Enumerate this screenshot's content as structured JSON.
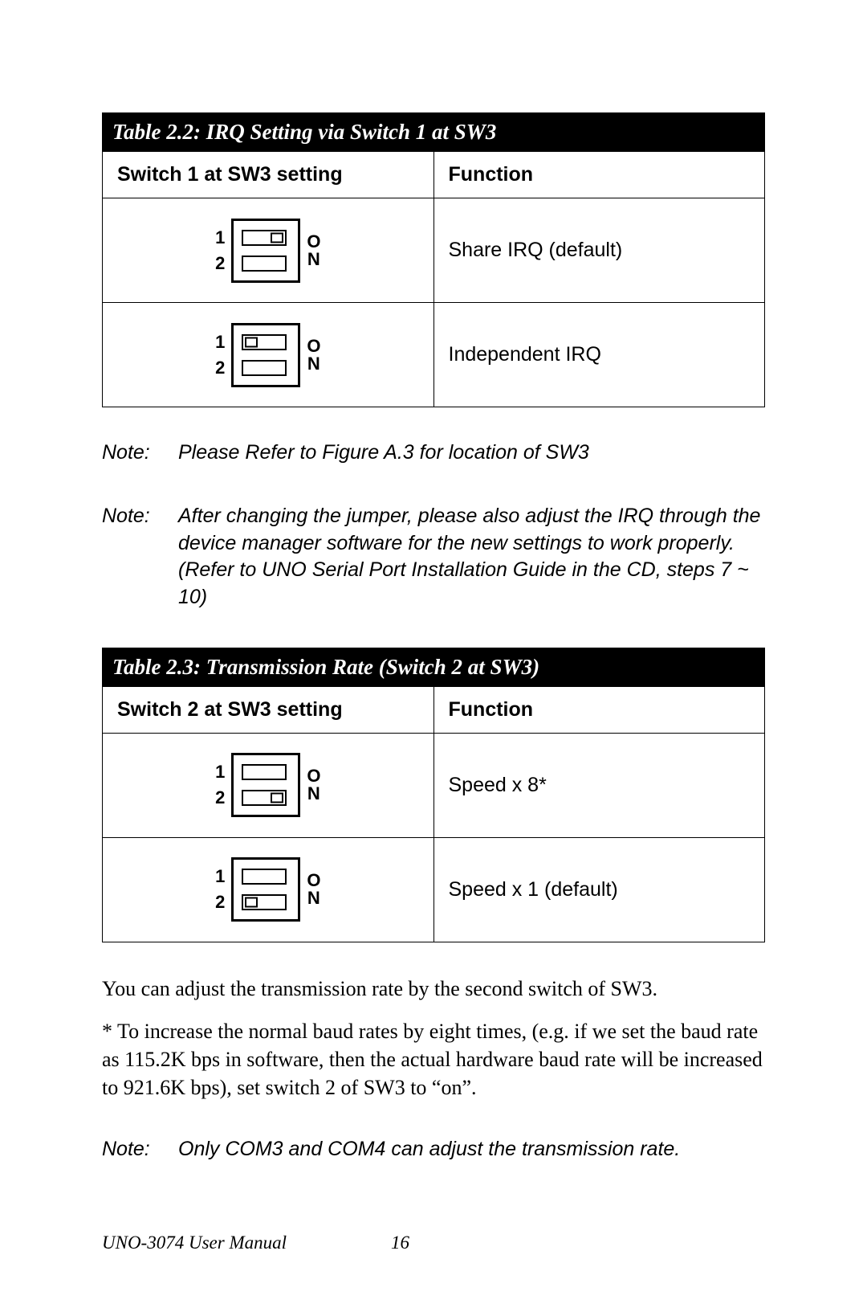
{
  "table1": {
    "title": "Table 2.2: IRQ Setting via Switch 1 at SW3",
    "col1": "Switch 1 at  SW3 setting",
    "col2": "Function",
    "rows": [
      {
        "sw1": "right",
        "sw2": "none",
        "func": "Share IRQ (default)"
      },
      {
        "sw1": "left",
        "sw2": "none",
        "func": "Independent IRQ"
      }
    ]
  },
  "table2": {
    "title": "Table 2.3: Transmission Rate (Switch 2 at SW3)",
    "col1": "Switch 2 at SW3 setting",
    "col2": "Function",
    "rows": [
      {
        "sw1": "none",
        "sw2": "right",
        "func": "Speed x 8*"
      },
      {
        "sw1": "none",
        "sw2": "left",
        "func": "Speed x 1 (default)"
      }
    ]
  },
  "switch_labels": {
    "num1": "1",
    "num2": "2",
    "o": "O",
    "n": "N"
  },
  "notes": {
    "label": "Note:",
    "n1": "Please Refer to Figure A.3 for location of SW3",
    "n2": "After changing the jumper, please also adjust the IRQ through the device manager software for the new settings to work properly. (Refer to UNO Serial Port Installation Guide in the CD, steps 7 ~ 10)",
    "n3": "Only COM3 and COM4 can adjust the transmission rate."
  },
  "paras": {
    "p1": "You can adjust the transmission rate by the second switch of SW3.",
    "p2": "* To increase the normal baud rates by eight times, (e.g. if we set the baud rate as 115.2K bps in software, then the actual hardware baud rate will be increased to 921.6K bps), set switch 2 of SW3 to “on”."
  },
  "footer": {
    "title": "UNO-3074 User Manual",
    "page": "16"
  }
}
